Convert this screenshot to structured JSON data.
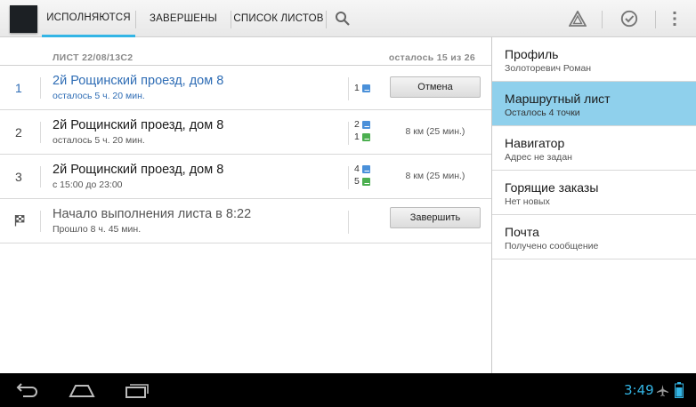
{
  "tabs": [
    {
      "label": "ИСПОЛНЯЮТСЯ"
    },
    {
      "label": "ЗАВЕРШЕНЫ"
    },
    {
      "label": "СПИСОК ЛИСТОВ"
    }
  ],
  "list_header": {
    "sheet": "ЛИСТ 22/08/13C2",
    "remaining": "осталось 15 из 26"
  },
  "rows": [
    {
      "num": "1",
      "title": "2й Рощинский проезд, дом 8",
      "subtitle": "осталось 5 ч. 20 мин.",
      "counts": [
        "1"
      ],
      "button": "Отмена"
    },
    {
      "num": "2",
      "title": "2й Рощинский проезд, дом 8",
      "subtitle": "осталось 5 ч. 20 мин.",
      "counts": [
        "2",
        "1"
      ],
      "distance": "8 км (25 мин.)"
    },
    {
      "num": "3",
      "title": "2й Рощинский проезд, дом 8",
      "subtitle": "с 15:00 до 23:00",
      "counts": [
        "4",
        "5"
      ],
      "distance": "8 км (25 мин.)"
    },
    {
      "title": "Начало выполнения листа в 8:22",
      "subtitle": "Прошло 8 ч. 45 мин.",
      "button": "Завершить"
    }
  ],
  "menu": [
    {
      "title": "Профиль",
      "subtitle": "Золоторевич Роман"
    },
    {
      "title": "Маршрутный лист",
      "subtitle": "Осталось 4 точки"
    },
    {
      "title": "Навигатор",
      "subtitle": "Адрес не задан"
    },
    {
      "title": "Горящие заказы",
      "subtitle": "Нет новых"
    },
    {
      "title": "Почта",
      "subtitle": "Получено сообщение"
    }
  ],
  "status": {
    "time": "3:49"
  },
  "colors": {
    "accent": "#33b5e5",
    "selected": "#8fd0ec",
    "link": "#2f6db5",
    "pickup": "#4a90d9",
    "dropoff": "#4caf50"
  },
  "icons": [
    "app-icon",
    "search-icon",
    "warning-icon",
    "checkmark-icon",
    "overflow-menu-icon",
    "flag-icon",
    "back-icon",
    "home-icon",
    "recent-apps-icon",
    "airplane-icon",
    "battery-icon"
  ]
}
